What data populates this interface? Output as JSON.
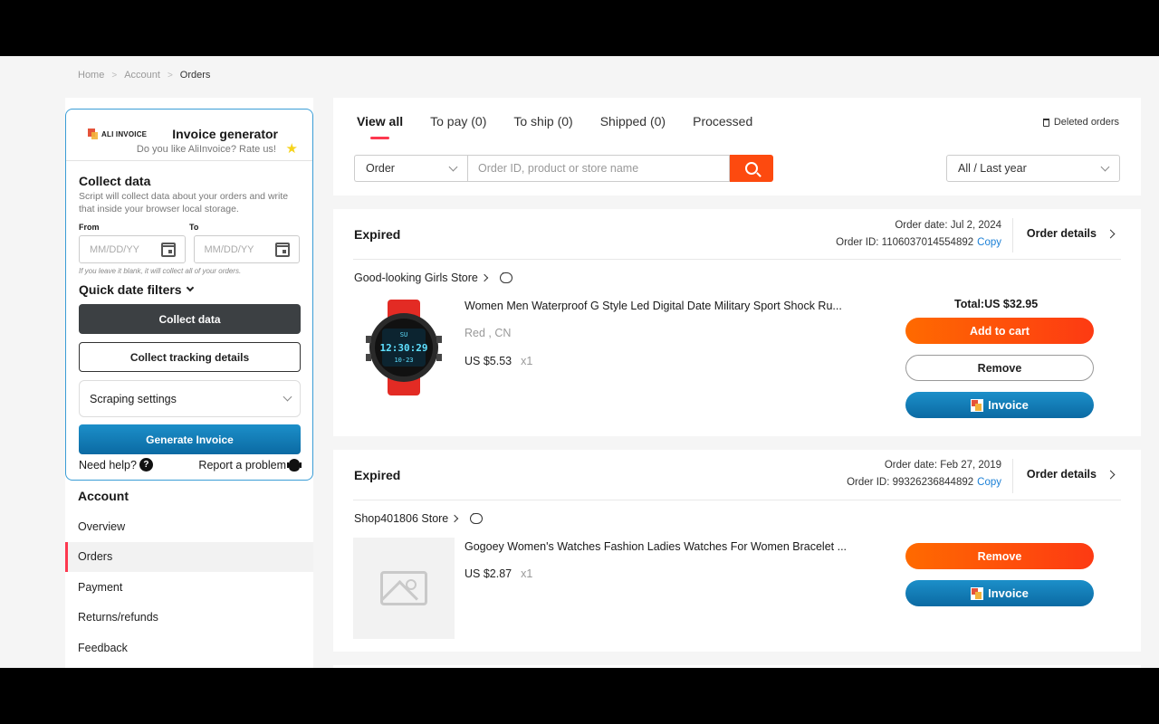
{
  "breadcrumb": [
    "Home",
    "Account",
    "Orders"
  ],
  "extension": {
    "logo_text": "ALI INVOICE",
    "title": "Invoice generator",
    "subtitle": "Do you like AliInvoice? Rate us!",
    "collect_title": "Collect data",
    "collect_desc": "Script will collect data about your orders and write that inside your browser local storage.",
    "from_label": "From",
    "to_label": "To",
    "date_placeholder": "MM/DD/YY",
    "hint": "If you leave it blank, it will collect all of your orders.",
    "quick_filters": "Quick date filters",
    "collect_button": "Collect data",
    "tracking_button": "Collect tracking details",
    "scraping_settings": "Scraping settings",
    "generate_button": "Generate Invoice",
    "need_help": "Need help?",
    "report_problem": "Report a problem"
  },
  "account": {
    "title": "Account",
    "items": [
      "Overview",
      "Orders",
      "Payment",
      "Returns/refunds",
      "Feedback"
    ],
    "active_index": 1
  },
  "tabs": [
    "View all",
    "To pay (0)",
    "To ship (0)",
    "Shipped (0)",
    "Processed"
  ],
  "deleted_orders": "Deleted orders",
  "search": {
    "type": "Order",
    "placeholder": "Order ID, product or store name",
    "period": "All / Last year"
  },
  "orders": [
    {
      "status": "Expired",
      "date_label": "Order date: Jul 2, 2024",
      "id_label": "Order ID: 1106037014554892",
      "copy": "Copy",
      "details": "Order details",
      "store": "Good-looking Girls Store",
      "title": "Women Men Waterproof G Style Led Digital Date Military Sport Shock Ru...",
      "attr": "Red , CN",
      "price": "US $5.53",
      "qty": "x1",
      "total": "Total:US $32.95",
      "buttons": [
        "Add to cart",
        "Remove",
        "Invoice"
      ]
    },
    {
      "status": "Expired",
      "date_label": "Order date: Feb 27, 2019",
      "id_label": "Order ID: 99326236844892",
      "copy": "Copy",
      "details": "Order details",
      "store": "Shop401806 Store",
      "title": "Gogoey Women's Watches Fashion Ladies Watches For Women Bracelet ...",
      "price": "US $2.87",
      "qty": "x1",
      "buttons": [
        "Remove",
        "Invoice"
      ]
    }
  ],
  "watch_display": {
    "top": "SU",
    "time": "12:30:29",
    "date": "10-23"
  },
  "colors": {
    "accent": "#fd384f",
    "orange": "#fd4a0f",
    "invoice_blue": "#0b6aa3"
  }
}
